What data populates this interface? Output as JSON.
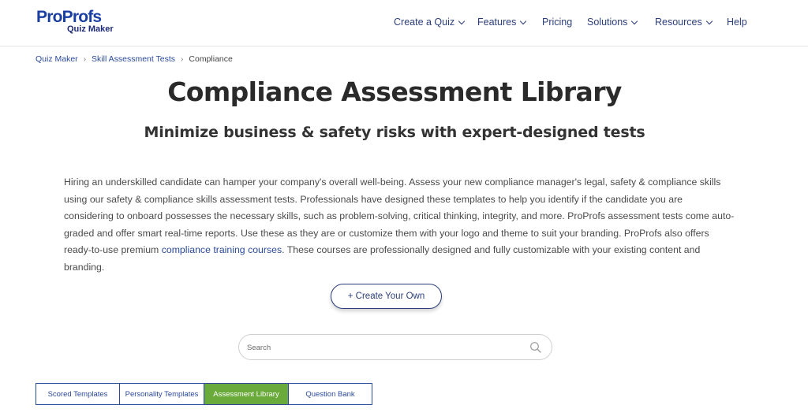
{
  "logo": {
    "part1": "Pro",
    "part2": "Profs",
    "sub": "Quiz Maker"
  },
  "nav": {
    "items": [
      {
        "label": "Create a Quiz",
        "has_dropdown": true
      },
      {
        "label": "Features",
        "has_dropdown": true
      },
      {
        "label": "Pricing",
        "has_dropdown": false
      },
      {
        "label": "Solutions",
        "has_dropdown": true
      },
      {
        "label": "Resources",
        "has_dropdown": true
      },
      {
        "label": "Help",
        "has_dropdown": false
      }
    ]
  },
  "breadcrumb": {
    "items": [
      "Quiz Maker",
      "Skill Assessment Tests"
    ],
    "current": "Compliance",
    "separator": "›"
  },
  "page": {
    "title": "Compliance Assessment Library",
    "subtitle": "Minimize business & safety risks with expert-designed tests",
    "description_before_link": "Hiring an underskilled candidate can hamper your company's overall well-being. Assess your new compliance manager's legal, safety & compliance skills using our safety & compliance skills assessment tests. Professionals have designed these templates to help you identify if the candidate you are considering to onboard possesses the necessary skills, such as problem-solving, critical thinking, integrity, and more. ProProfs assessment tests come auto-graded and offer smart real-time reports. Use these as they are or customize them with your logo and theme to suit your branding. ProProfs also offers ready-to-use premium ",
    "description_link": "compliance training courses",
    "description_after_link": ". These courses are professionally designed and fully customizable with your existing content and branding.",
    "create_button": "+ Create Your Own"
  },
  "search": {
    "placeholder": "Search",
    "value": "",
    "icon": "search-icon"
  },
  "tabs": {
    "items": [
      {
        "label": "Scored Templates",
        "active": false
      },
      {
        "label": "Personality Templates",
        "active": false
      },
      {
        "label": "Assessment Library",
        "active": true
      },
      {
        "label": "Question Bank",
        "active": false
      }
    ]
  },
  "colors": {
    "brand_blue": "#2b3e7c",
    "link_blue": "#2b4a9b",
    "active_tab": "#6aaa3a"
  }
}
